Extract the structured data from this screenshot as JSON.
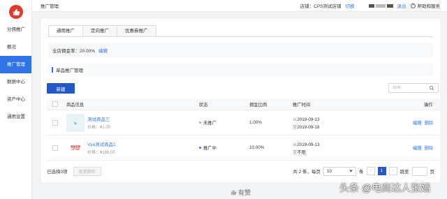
{
  "sidebar": {
    "logo_icon": "thumbs-up-icon",
    "items": [
      {
        "label": "分佣推广",
        "active": false
      },
      {
        "label": "概况",
        "active": false
      },
      {
        "label": "推广管理",
        "active": true
      },
      {
        "label": "数据中心",
        "active": false
      },
      {
        "label": "资产中心",
        "active": false
      },
      {
        "label": "通用设置",
        "active": false
      }
    ]
  },
  "topbar": {
    "breadcrumb": "推广管理",
    "store_label": "店铺：",
    "store_name": "CPS测试店铺",
    "switch_label": "切换",
    "logout_label": "退出",
    "help_label": "帮助和服务"
  },
  "tabs": [
    "通用推广",
    "定向推广",
    "优惠券推广"
  ],
  "rate": {
    "label": "全店佣金率：",
    "value": "20.00%",
    "edit_label": "编辑"
  },
  "section_title": "单品推广管理",
  "new_button": "新建",
  "search": {
    "placeholder": "搜索"
  },
  "table": {
    "headers": [
      "商品信息",
      "状态",
      "佣金比例",
      "推广时间",
      "操作"
    ],
    "rows": [
      {
        "name": "测试商品三",
        "price": "价格：¥1.00",
        "status": "未推广",
        "rate": "1.00%",
        "from_prefix": "从",
        "from": "2019-09-13",
        "to_prefix": "至",
        "to": "2019-09-18",
        "edit": "编辑",
        "delete": "删除",
        "thumb_text": "",
        "status_color": "#aaaaaa"
      },
      {
        "name": "Vya测试商品1",
        "price": "价格：¥166.00",
        "status": "推广中",
        "rate": "10.00%",
        "from_prefix": "从",
        "from": "2019-09-13",
        "to_prefix": "至",
        "to": "不限",
        "edit": "编辑",
        "delete": "删除",
        "thumb_text": "商品包装 OTTER",
        "status_color": "#2f74e6"
      }
    ]
  },
  "footer": {
    "selected": "已选择0项",
    "batch_delete": "批量删除",
    "total": "共 2 条，每页",
    "per_page": "10",
    "per_page_unit": "条",
    "prev": "‹",
    "current_page": "1",
    "next": "›",
    "goto_label": "跳至",
    "page_unit": "页"
  },
  "brand": "有赞",
  "watermark": "头条 @电商达人张嫱",
  "colors": {
    "accent": "#2f74e6",
    "primary_button": "#2358c8",
    "logo": "#e03a2e"
  }
}
